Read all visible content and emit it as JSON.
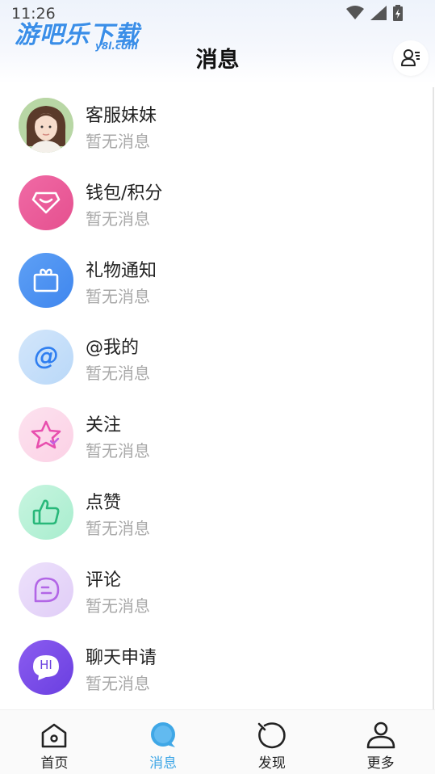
{
  "status_bar": {
    "time": "11:26"
  },
  "watermark": {
    "text": "游吧乐下载",
    "sub": "y8l.com"
  },
  "header": {
    "title": "消息"
  },
  "messages": [
    {
      "name": "客服妹妹",
      "preview": "暂无消息"
    },
    {
      "name": "钱包/积分",
      "preview": "暂无消息"
    },
    {
      "name": "礼物通知",
      "preview": "暂无消息"
    },
    {
      "name": "@我的",
      "preview": "暂无消息"
    },
    {
      "name": "关注",
      "preview": "暂无消息"
    },
    {
      "name": "点赞",
      "preview": "暂无消息"
    },
    {
      "name": "评论",
      "preview": "暂无消息"
    },
    {
      "name": "聊天申请",
      "preview": "暂无消息"
    }
  ],
  "chat_request_icon_text": "HI",
  "tabs": [
    {
      "label": "首页",
      "icon": "home-icon"
    },
    {
      "label": "消息",
      "icon": "message-icon",
      "active": true
    },
    {
      "label": "发现",
      "icon": "discover-icon"
    },
    {
      "label": "更多",
      "icon": "profile-icon"
    }
  ],
  "colors": {
    "accent": "#3fa7e6",
    "wallet": "#ec5b9b",
    "gift": "#4a8ff0",
    "chat_request": "#7a4ee8"
  }
}
